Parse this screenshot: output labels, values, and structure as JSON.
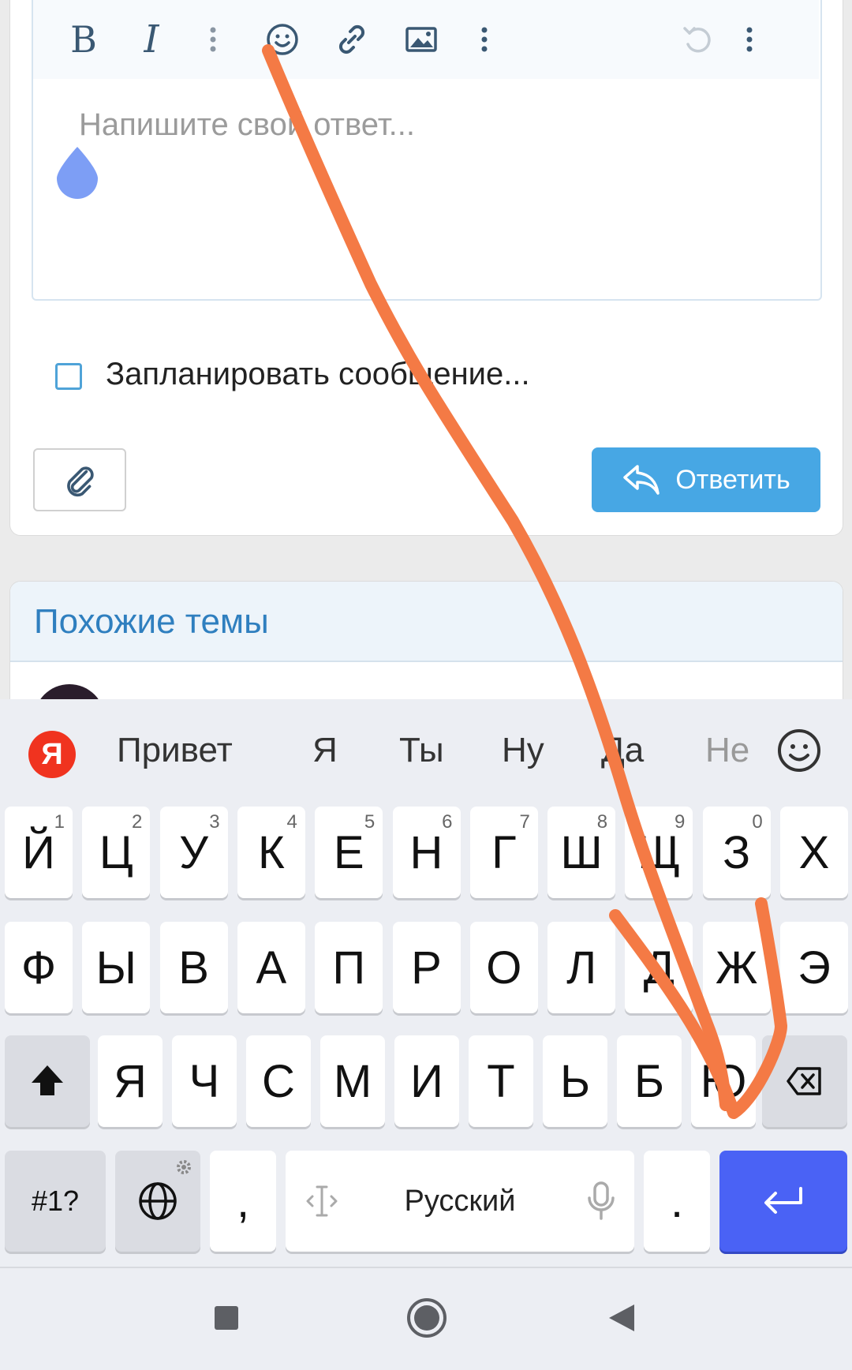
{
  "editor": {
    "toolbar": {
      "bold_label": "B",
      "italic_label": "I",
      "icons": [
        "bold-icon",
        "italic-icon",
        "more-vertical-icon",
        "smile-icon",
        "link-icon",
        "image-icon",
        "more-vertical-icon",
        "undo-icon",
        "more-vertical-icon"
      ]
    },
    "placeholder": "Напишите свой ответ..."
  },
  "schedule": {
    "label": "Запланировать сообщение..."
  },
  "actions": {
    "reply_label": "Ответить"
  },
  "similar": {
    "title": "Похожие темы"
  },
  "keyboard": {
    "logo": "Я",
    "suggestions": [
      "Привет",
      "Я",
      "Ты",
      "Ну",
      "Да",
      "Не"
    ],
    "row1": [
      {
        "k": "Й",
        "n": "1"
      },
      {
        "k": "Ц",
        "n": "2"
      },
      {
        "k": "У",
        "n": "3"
      },
      {
        "k": "К",
        "n": "4"
      },
      {
        "k": "Е",
        "n": "5"
      },
      {
        "k": "Н",
        "n": "6"
      },
      {
        "k": "Г",
        "n": "7"
      },
      {
        "k": "Ш",
        "n": "8"
      },
      {
        "k": "Щ",
        "n": "9"
      },
      {
        "k": "З",
        "n": "0"
      },
      {
        "k": "Х",
        "n": ""
      }
    ],
    "row2": [
      "Ф",
      "Ы",
      "В",
      "А",
      "П",
      "Р",
      "О",
      "Л",
      "Д",
      "Ж",
      "Э"
    ],
    "row3": [
      "Я",
      "Ч",
      "С",
      "М",
      "И",
      "Т",
      "Ь",
      "Б",
      "Ю"
    ],
    "symbols_label": "#1?",
    "comma": ",",
    "space_label": "Русский",
    "period": "."
  },
  "colors": {
    "accent": "#47a7e4",
    "enter": "#4a62f5",
    "annotation": "#f47a45"
  }
}
